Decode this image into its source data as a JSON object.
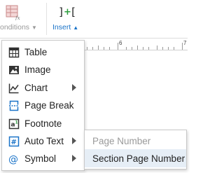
{
  "toolbar": {
    "conditions_label": "onditions",
    "insert_label": "Insert"
  },
  "ruler": {
    "labels": [
      "6",
      "7"
    ]
  },
  "insert_menu": {
    "items": [
      {
        "label": "Table",
        "icon": "table-icon",
        "has_submenu": false
      },
      {
        "label": "Image",
        "icon": "image-icon",
        "has_submenu": false
      },
      {
        "label": "Chart",
        "icon": "chart-icon",
        "has_submenu": true
      },
      {
        "label": "Page Break",
        "icon": "page-break-icon",
        "has_submenu": false
      },
      {
        "label": "Footnote",
        "icon": "footnote-icon",
        "has_submenu": false
      },
      {
        "label": "Auto Text",
        "icon": "auto-text-icon",
        "has_submenu": true
      },
      {
        "label": "Symbol",
        "icon": "symbol-icon",
        "has_submenu": true
      }
    ]
  },
  "auto_text_submenu": {
    "items": [
      {
        "label": "Page Number",
        "state": "disabled"
      },
      {
        "label": "Section Page Number",
        "state": "hover"
      }
    ]
  },
  "colors": {
    "accent": "#1a73c8",
    "green": "#2e9e3e",
    "disabled": "#9a9a9a",
    "hover_bg": "#e6eef6"
  }
}
